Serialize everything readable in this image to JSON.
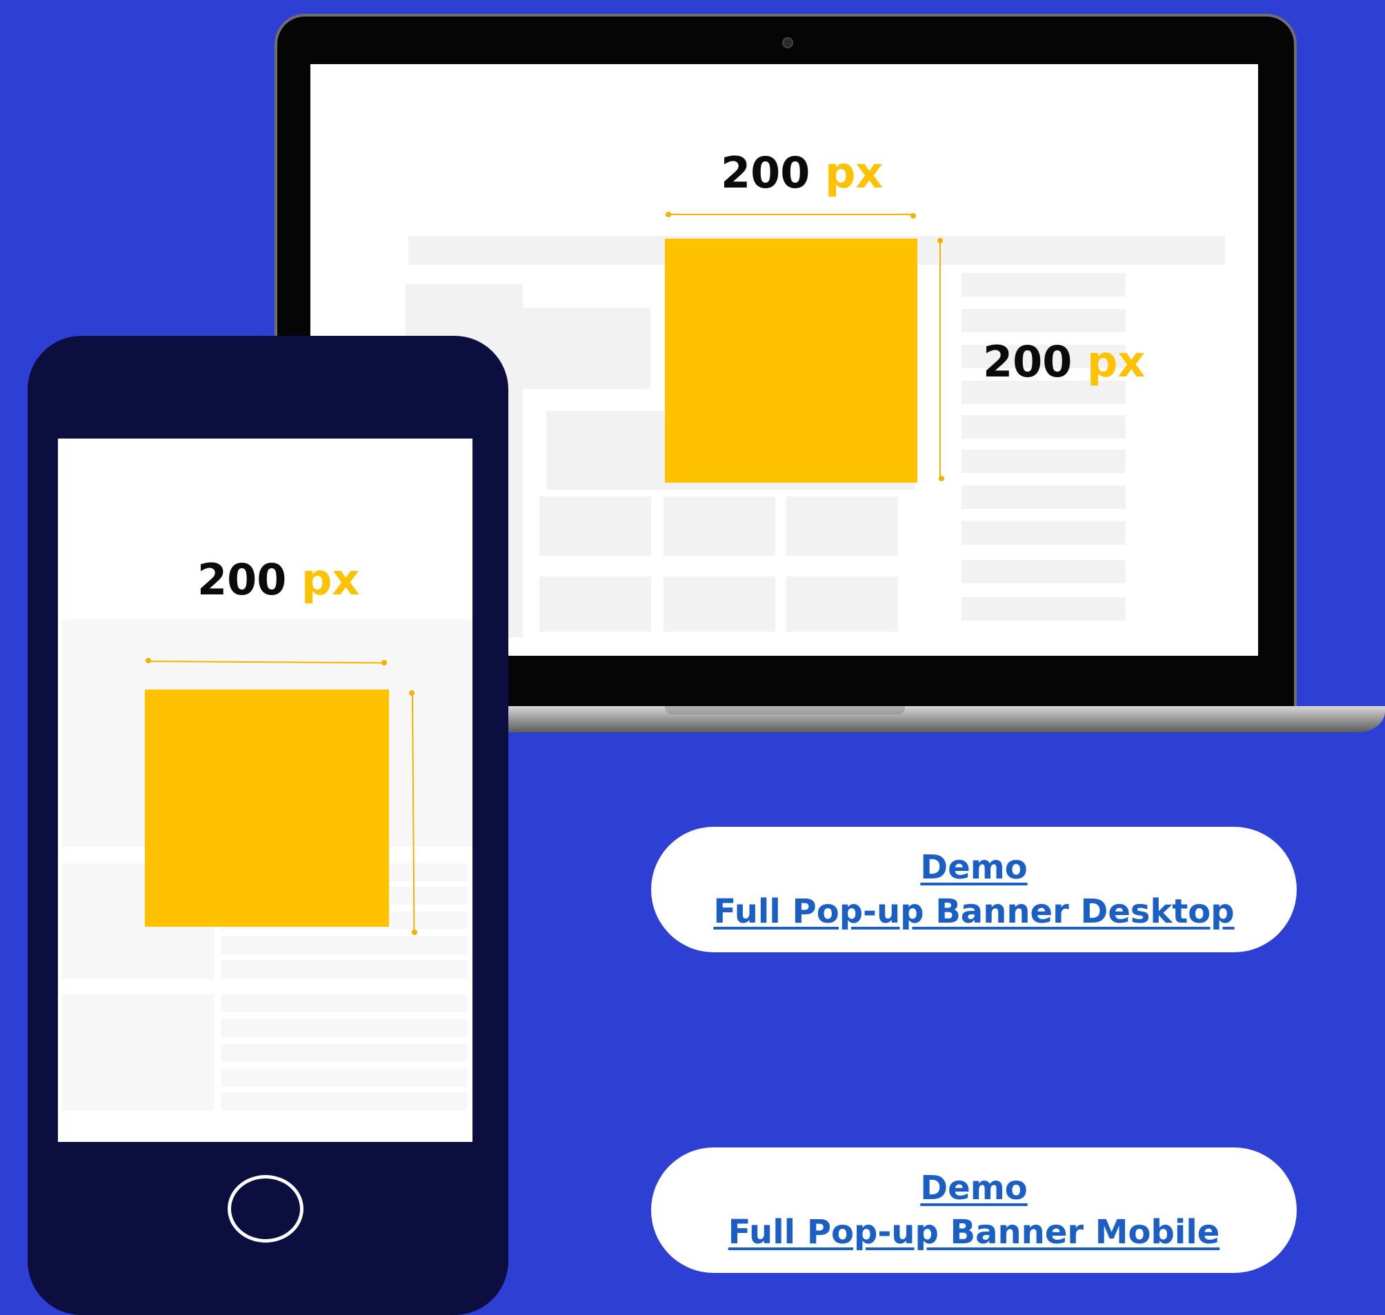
{
  "laptop": {
    "width_label": {
      "value": "200",
      "unit": "px"
    },
    "height_label": {
      "value": "200",
      "unit": "px"
    }
  },
  "phone": {
    "width_label": {
      "value": "200",
      "unit": "px"
    }
  },
  "buttons": [
    {
      "line1": "Demo",
      "line2": "Full Pop-up Banner Desktop"
    },
    {
      "line1": "Demo",
      "line2": "Full Pop-up Banner Mobile"
    }
  ],
  "colors": {
    "background": "#2e40d4",
    "banner": "#ffc200",
    "phone_body": "#0d0e40",
    "link": "#1b5ec4"
  },
  "icons": {
    "camera": "laptop-camera-icon",
    "home": "phone-home-button-icon"
  }
}
